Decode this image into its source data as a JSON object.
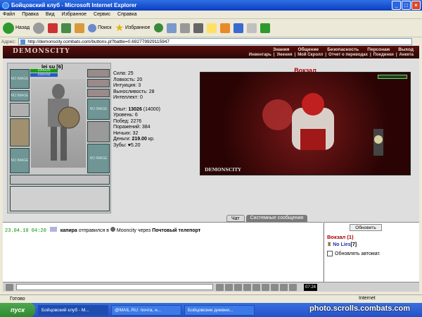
{
  "window": {
    "title": "Бойцовский клуб - Microsoft Internet Explorer",
    "min": "_",
    "max": "□",
    "close": "×"
  },
  "menu": [
    "Файл",
    "Правка",
    "Вид",
    "Избранное",
    "Сервис",
    "Справка"
  ],
  "toolbar": {
    "back": "Назад",
    "search": "Поиск",
    "favorites": "Избранное"
  },
  "address": {
    "label": "Адрес:",
    "url": "http://demonscity.combats.com/buttons.pl?battle=0.692779929115947"
  },
  "game": {
    "logo": "DEMONSCITY",
    "top_links": [
      "Знания",
      "Общение",
      "Безопасность",
      "Персонаж",
      "Выход"
    ],
    "sub_links": [
      "Инвентарь",
      "Умения",
      "Мой Скролл",
      "Отчет о переводах",
      "Поединки",
      "Анкета"
    ],
    "nick": "lei su [6]",
    "hp": "220/220",
    "mp": "232/232",
    "slot_label": "NO IMAGE",
    "stats": [
      "Сила: 25",
      "Ловкость: 20",
      "Интуиция: 3",
      "Выносливость: 28",
      "Интеллект: 0"
    ],
    "exp_label": "Опыт:",
    "exp_value": "13026",
    "exp_next": "(14000)",
    "stats2": [
      "Уровень: 6",
      "Побед: 2276",
      "Поражений: 384",
      "Ничьих: 32"
    ],
    "money_label": "Деньги:",
    "money_value": "219.00",
    "money_unit": "кр.",
    "teeth": "Зубы: ♥5.20",
    "location": "Вокзал",
    "scene_logo": "DEMONSCITY"
  },
  "tabs": [
    "Чат",
    "Системные сообщения"
  ],
  "chat": {
    "time": "23.04.10 04:20",
    "user": "капира",
    "text1": "отправился в",
    "city": "Mooncity",
    "text2": "через",
    "target": "Почтовый телепорт"
  },
  "room": {
    "button": "Обновить",
    "location": "Вокзал (1)",
    "player": "No Lies",
    "player_level": "[7]",
    "auto": "Обновлять автомат."
  },
  "clock": "07:24",
  "status": {
    "left": "Готово",
    "zone": "Internet"
  },
  "taskbar": {
    "start": "пуск",
    "tasks": [
      "Бойцовский клуб - M...",
      "@MAIL.RU: почта, н...",
      "Бойцовские дневни..."
    ]
  },
  "watermark": "photo.scrolls.combats.com"
}
